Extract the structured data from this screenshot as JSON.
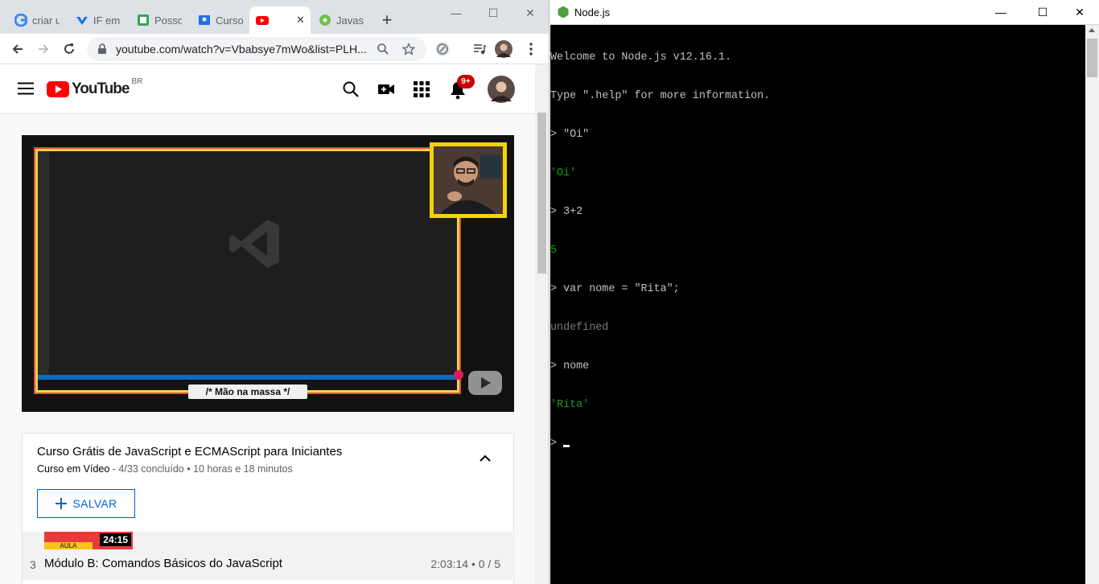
{
  "browser": {
    "tabs": [
      {
        "label": "criar u",
        "favicon": "google-icon",
        "color": "#4285f4"
      },
      {
        "label": "IF em",
        "favicon": "if-logo-icon",
        "color": "#1a73e8"
      },
      {
        "label": "Posso",
        "favicon": "document-icon",
        "color": "#34a853"
      },
      {
        "label": "Curso",
        "favicon": "classroom-icon",
        "color": "#1a73e8"
      },
      {
        "label": "",
        "favicon": "youtube-icon",
        "color": "#ff0000",
        "active": true,
        "audio": "speaker-icon",
        "close": "✕"
      },
      {
        "label": "Javasc",
        "favicon": "node-icon",
        "color": "#6cc24a"
      }
    ],
    "new_tab": "+",
    "url": "youtube.com/watch?v=Vbabsye7mWo&list=PLH...",
    "window_controls": {
      "minimize": "—",
      "maximize": "☐",
      "close": "✕"
    }
  },
  "youtube": {
    "logo_text": "YouTube",
    "region": "BR",
    "notification_count": "9+",
    "video": {
      "overlay_caption": "/* Mão na massa */"
    },
    "playlist": {
      "title": "Curso Grátis de JavaScript e ECMAScript para Iniciantes",
      "channel": "Curso em Vídeo",
      "progress": " - 4/33 concluído • 10 horas e 18 minutos",
      "save_label": "SALVAR",
      "item": {
        "index": "3",
        "thumb_duration": "24:15",
        "thumb_label": "AULA",
        "title": "Módulo B: Comandos Básicos do JavaScript",
        "meta": "2:03:14 • 0 / 5"
      }
    }
  },
  "node_window": {
    "title": "Node.js",
    "controls": {
      "minimize": "—",
      "maximize": "☐",
      "close": "✕"
    },
    "console_lines": [
      {
        "text": "Welcome to Node.js v12.16.1.",
        "style": "normal"
      },
      {
        "text": "Type \".help\" for more information.",
        "style": "normal"
      },
      {
        "text": "> \"Oi\"",
        "style": "normal"
      },
      {
        "text": "'Oi'",
        "style": "green"
      },
      {
        "text": "> 3+2",
        "style": "normal"
      },
      {
        "text": "5",
        "style": "green"
      },
      {
        "text": "> var nome = \"Rita\";",
        "style": "normal"
      },
      {
        "text": "undefined",
        "style": "gray"
      },
      {
        "text": "> nome",
        "style": "normal"
      },
      {
        "text": "'Rita'",
        "style": "green"
      },
      {
        "text": "> ",
        "style": "prompt"
      }
    ]
  },
  "colors": {
    "youtube_red": "#ff0000",
    "link_blue": "#065fd4",
    "console_green": "#12a012",
    "console_gray": "#787878",
    "console_fg": "#c0c0c0"
  }
}
